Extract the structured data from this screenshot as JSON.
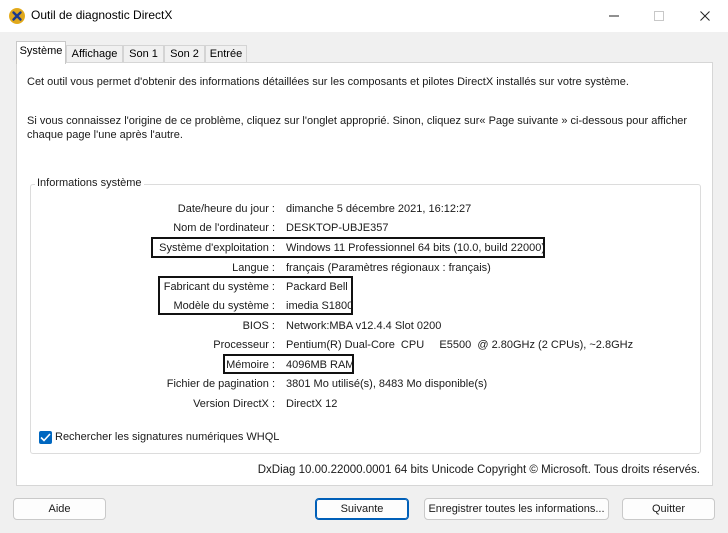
{
  "window": {
    "title": "Outil de diagnostic DirectX"
  },
  "icons": {
    "app": "directx-icon",
    "minimize": "minimize-icon",
    "maximize": "maximize-icon",
    "close": "close-icon",
    "check": "check-icon"
  },
  "tabs": [
    {
      "label": "Système",
      "active": true
    },
    {
      "label": "Affichage"
    },
    {
      "label": "Son 1"
    },
    {
      "label": "Son 2"
    },
    {
      "label": "Entrée"
    }
  ],
  "intro": {
    "line1": "Cet outil vous permet d'obtenir des informations détaillées sur les composants et pilotes DirectX installés sur votre système.",
    "line2": "Si vous connaissez l'origine de ce problème, cliquez sur l'onglet approprié. Sinon, cliquez sur« Page suivante » ci-dessous pour afficher",
    "line3": "chaque page l'une après l'autre."
  },
  "system_info": {
    "title": "Informations système",
    "rows": [
      {
        "label": "Date/heure du jour :",
        "value": "dimanche 5 décembre 2021, 16:12:27"
      },
      {
        "label": "Nom de l'ordinateur :",
        "value": "DESKTOP-UBJE357"
      },
      {
        "label": "Système d'exploitation :",
        "value": "Windows 11 Professionnel 64 bits (10.0, build 22000)"
      },
      {
        "label": "Langue :",
        "value": "français (Paramètres régionaux : français)"
      },
      {
        "label": "Fabricant du système :",
        "value": "Packard Bell"
      },
      {
        "label": "Modèle du système :",
        "value": "imedia S1800"
      },
      {
        "label": "BIOS :",
        "value": "Network:MBA v12.4.4 Slot 0200"
      },
      {
        "label": "Processeur :",
        "value": "Pentium(R) Dual-Core  CPU     E5500  @ 2.80GHz (2 CPUs), ~2.8GHz"
      },
      {
        "label": "Mémoire :",
        "value": "4096MB RAM"
      },
      {
        "label": "Fichier de pagination :",
        "value": "3801 Mo utilisé(s), 8483 Mo disponible(s)"
      },
      {
        "label": "Version DirectX :",
        "value": "DirectX 12"
      }
    ]
  },
  "whql": {
    "label": "Rechercher les signatures numériques WHQL",
    "checked": true
  },
  "copyright": "DxDiag 10.00.22000.0001 64 bits Unicode Copyright © Microsoft. Tous droits réservés.",
  "buttons": {
    "help": "Aide",
    "next": "Suivante",
    "save": "Enregistrer toutes les informations...",
    "quit": "Quitter"
  },
  "colors": {
    "accent": "#0067c0",
    "highlight_border": "#111111"
  }
}
